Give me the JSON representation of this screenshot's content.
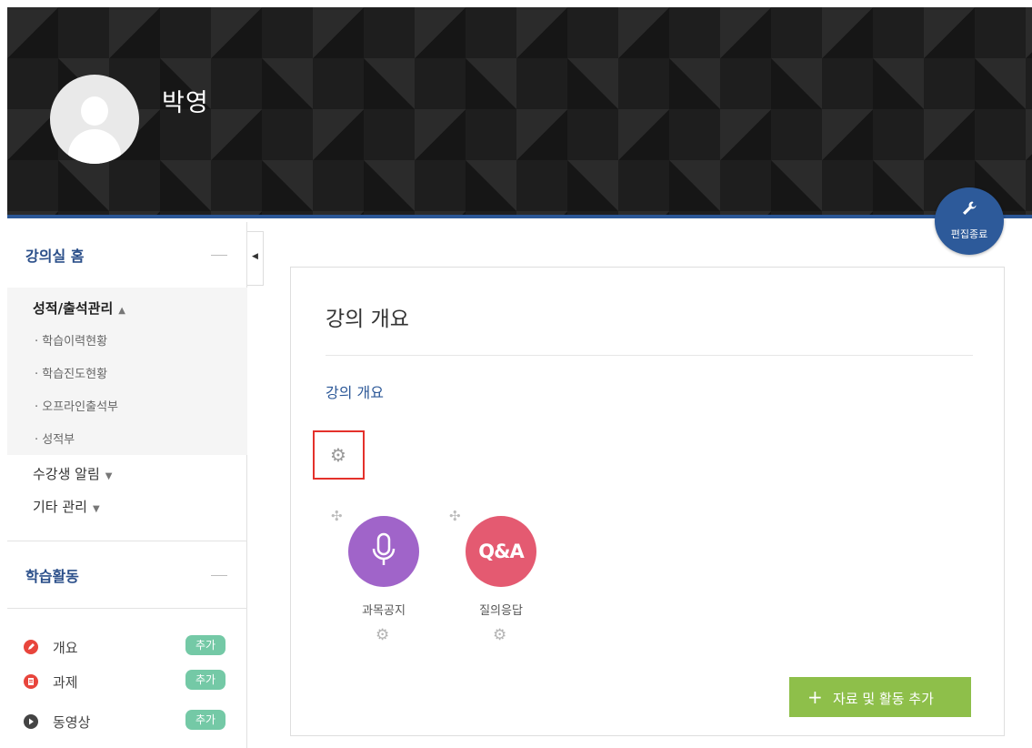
{
  "header": {
    "user_name": "박영",
    "edit_button_label": "편집종료"
  },
  "sidebar": {
    "section1": {
      "title": "강의실 홈",
      "menus": [
        {
          "label": "성적/출석관리",
          "caret": "▲"
        },
        {
          "label": "수강생 알림",
          "caret": "▼"
        },
        {
          "label": "기타 관리",
          "caret": "▼"
        }
      ],
      "submenu": [
        "· 학습이력현황",
        "· 학습진도현황",
        "· 오프라인출석부",
        "· 성적부"
      ]
    },
    "section2": {
      "title": "학습활동",
      "activities": [
        {
          "label": "개요",
          "add": "추가",
          "icon": "pencil-icon",
          "color": "#e8453c"
        },
        {
          "label": "과제",
          "add": "추가",
          "icon": "document-icon",
          "color": "#e8453c"
        },
        {
          "label": "동영상",
          "add": "추가",
          "icon": "play-icon",
          "color": "#444444"
        }
      ]
    }
  },
  "main": {
    "title": "강의 개요",
    "link": "강의 개요",
    "activities": [
      {
        "name": "과목공지",
        "icon": "microphone-icon",
        "color": "#a064c9"
      },
      {
        "name": "질의응답",
        "icon_text": "Q&A",
        "color": "#e45a71"
      }
    ],
    "add_button_label": "자료 및 활동 추가",
    "add_button_plus": "+"
  },
  "colors": {
    "accent_blue": "#2d5a9a",
    "add_green": "#8ebf4a",
    "badge_green": "#74c9a6",
    "highlight_red": "#e4312b"
  }
}
